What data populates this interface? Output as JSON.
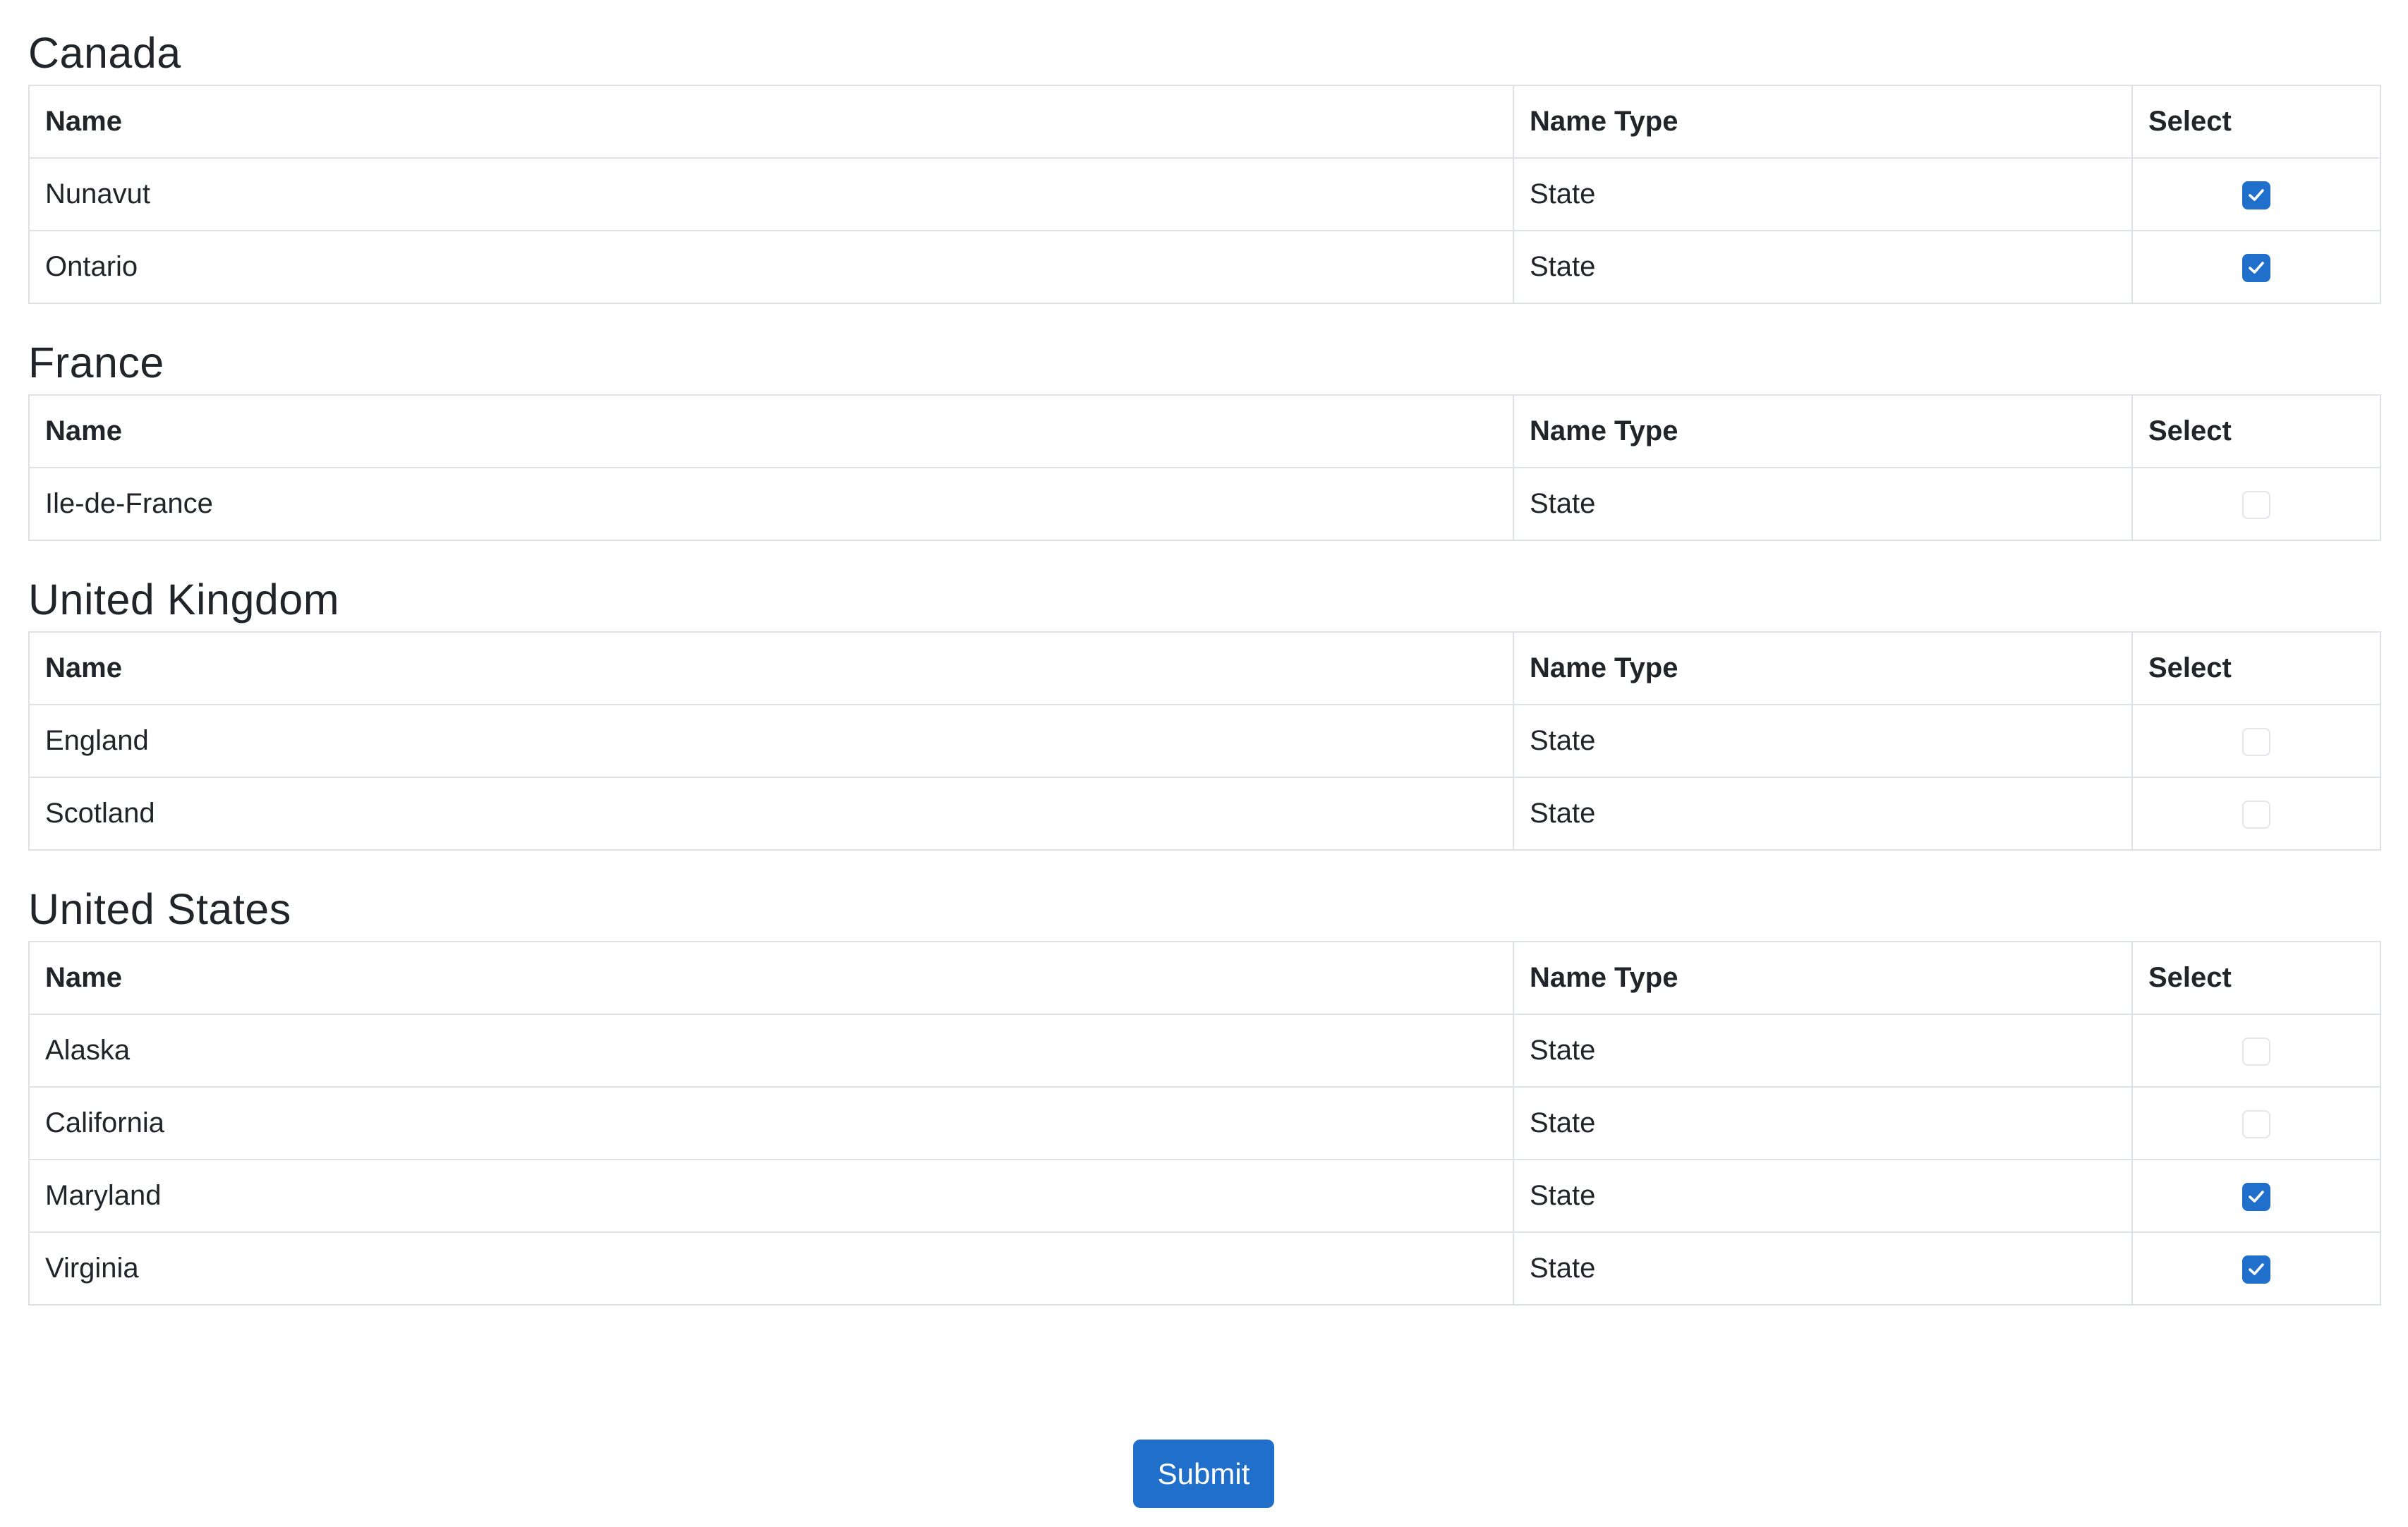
{
  "columns": {
    "name": "Name",
    "name_type": "Name Type",
    "select": "Select"
  },
  "sections": [
    {
      "country": "Canada",
      "rows": [
        {
          "name": "Nunavut",
          "name_type": "State",
          "selected": true
        },
        {
          "name": "Ontario",
          "name_type": "State",
          "selected": true
        }
      ]
    },
    {
      "country": "France",
      "rows": [
        {
          "name": "Ile-de-France",
          "name_type": "State",
          "selected": false
        }
      ]
    },
    {
      "country": "United Kingdom",
      "rows": [
        {
          "name": "England",
          "name_type": "State",
          "selected": false
        },
        {
          "name": "Scotland",
          "name_type": "State",
          "selected": false
        }
      ]
    },
    {
      "country": "United States",
      "rows": [
        {
          "name": "Alaska",
          "name_type": "State",
          "selected": false
        },
        {
          "name": "California",
          "name_type": "State",
          "selected": false
        },
        {
          "name": "Maryland",
          "name_type": "State",
          "selected": true
        },
        {
          "name": "Virginia",
          "name_type": "State",
          "selected": true
        }
      ]
    }
  ],
  "submit_label": "Submit",
  "colors": {
    "accent": "#1f6fcb",
    "border": "#dee2e6",
    "text": "#212529"
  }
}
